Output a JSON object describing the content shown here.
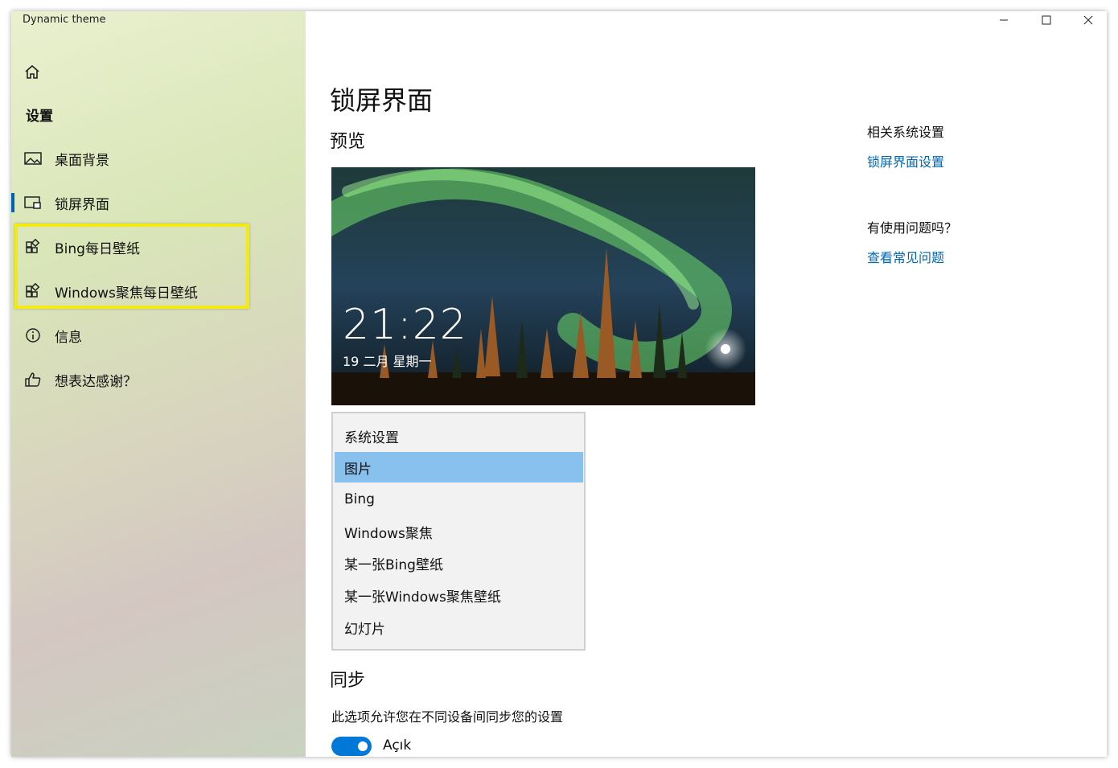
{
  "window": {
    "app_title": "Dynamic theme"
  },
  "sidebar": {
    "section_title": "设置",
    "items": [
      {
        "label": "桌面背景",
        "icon": "picture-icon"
      },
      {
        "label": "锁屏界面",
        "icon": "lock-screen-icon",
        "active": true
      },
      {
        "label": "Bing每日壁纸",
        "icon": "tiles-icon"
      },
      {
        "label": "Windows聚焦每日壁纸",
        "icon": "tiles-icon"
      },
      {
        "label": "信息",
        "icon": "info-icon"
      },
      {
        "label": "想表达感谢？",
        "icon": "thumbs-up-icon"
      }
    ]
  },
  "main": {
    "title": "锁屏界面",
    "preview_heading": "预览",
    "preview": {
      "time": "21:22",
      "date": "19 二月 星期一"
    },
    "dropdown": {
      "options": [
        "系统设置",
        "图片",
        "Bing",
        "Windows聚焦",
        "某一张Bing壁纸",
        "某一张Windows聚焦壁纸",
        "幻灯片"
      ],
      "selected_index": 1
    },
    "sync_heading": "同步",
    "sync_description": "此选项允许您在不同设备间同步您的设置",
    "sync_toggle": {
      "state": "on",
      "label": "Açık"
    }
  },
  "related": {
    "heading": "相关系统设置",
    "link": "锁屏界面设置",
    "help_heading": "有使用问题吗？",
    "help_link": "查看常见问题"
  },
  "colors": {
    "accent": "#0078d7",
    "link": "#0067b8",
    "selected_option": "#88c0ee",
    "highlight_box": "#f2ea12"
  }
}
